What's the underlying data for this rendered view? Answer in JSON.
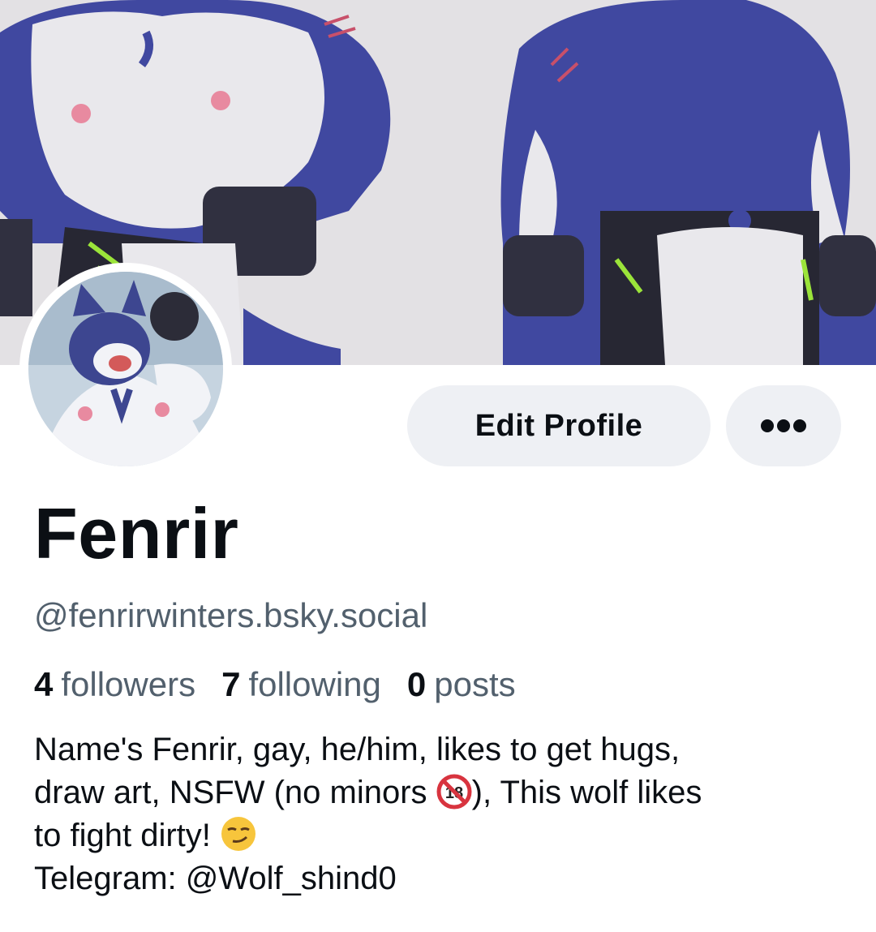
{
  "profile": {
    "display_name": "Fenrir",
    "handle": "@fenrirwinters.bsky.social",
    "stats": {
      "followers_count": "4",
      "followers_label": "followers",
      "following_count": "7",
      "following_label": "following",
      "posts_count": "0",
      "posts_label": "posts"
    },
    "bio": {
      "line1": "Name's Fenrir, gay, he/him, likes to get hugs,",
      "line2a": "draw art, NSFW (no minors ",
      "line2b": "), This wolf likes",
      "line3": "to fight dirty! ",
      "line4": "Telegram: @Wolf_shind0"
    }
  },
  "actions": {
    "edit_profile_label": "Edit Profile",
    "more_icon": "ellipsis-icon"
  },
  "icons": {
    "no_under_18": "no-one-under-eighteen-icon",
    "smirk": "smirking-face-icon"
  },
  "colors": {
    "button_bg": "#eef0f4",
    "secondary_text": "#52606d",
    "primary_text": "#0b0f14",
    "fur_blue": "#3f4ba0"
  }
}
